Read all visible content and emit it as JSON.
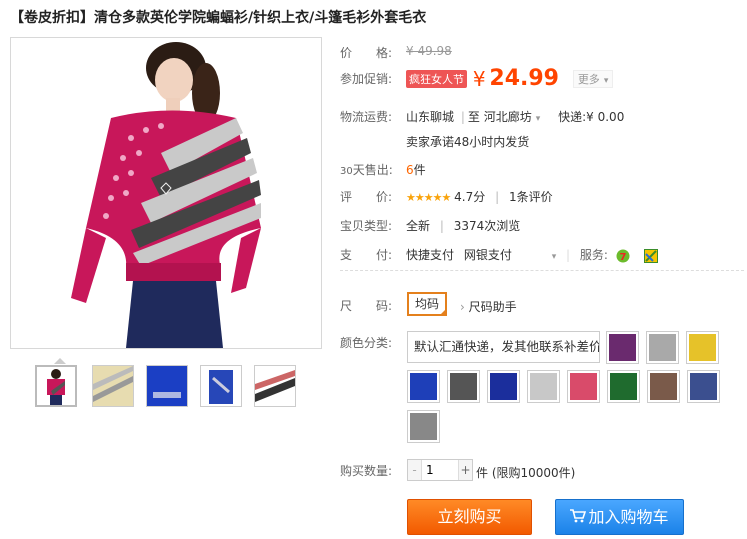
{
  "product": {
    "title": "【卷皮折扣】清仓多款英伦学院蝙蝠衫/针织上衣/斗篷毛衫外套毛衣"
  },
  "price": {
    "label": "价　　格:",
    "original": "¥ 49.98"
  },
  "promo": {
    "label": "参加促销:",
    "tag": "疯狂女人节",
    "currency": "¥",
    "value": "24.99",
    "more": "更多"
  },
  "shipping": {
    "label": "物流运费:",
    "from": "山东聊城",
    "to_prefix": "至",
    "to": "河北廊坊",
    "method": "快递:",
    "fee": "¥ 0.00",
    "promise": "卖家承诺48小时内发货"
  },
  "sales": {
    "label_prefix": "30",
    "label_suffix": "天售出:",
    "count": "6",
    "unit": "件"
  },
  "rating": {
    "label": "评　　价:",
    "stars": "★★★★★",
    "score": "4.7分",
    "reviews": "1条评价"
  },
  "item_type": {
    "label": "宝贝类型:",
    "condition": "全新",
    "views": "3374次浏览"
  },
  "payment": {
    "label": "支　　付:",
    "method1": "快捷支付",
    "method2": "网银支付",
    "service_label": "服务:"
  },
  "size": {
    "label": "尺　　码:",
    "selected": "均码",
    "helper": "尺码助手"
  },
  "color": {
    "label": "颜色分类:",
    "notice": "默认汇通快递，发其他联系补差价",
    "swatch_colors": [
      "#6a2a6e",
      "#a9a9a9",
      "#e6c229",
      "#1e3fb8",
      "#555555",
      "#1b2e9c",
      "#c8c8c8",
      "#d94b6a",
      "#1f6b2e",
      "#7a5a4a",
      "#3b4f8f",
      "#888888"
    ]
  },
  "quantity": {
    "label": "购买数量:",
    "minus": "-",
    "value": "1",
    "plus": "+",
    "limit": "件 (限购10000件)"
  },
  "actions": {
    "buy_now": "立刻购买",
    "add_cart": "加入购物车"
  },
  "colors": {
    "accent": "#ff4400",
    "buy_button": "#f25a00",
    "cart_button": "#1b82e8",
    "selected_border": "#e4801c"
  }
}
